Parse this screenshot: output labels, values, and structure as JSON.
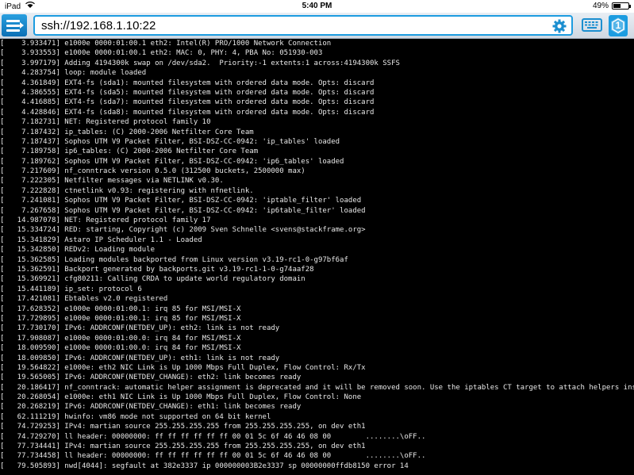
{
  "status_bar": {
    "device": "iPad",
    "time": "5:40 PM",
    "battery_percent": "49%",
    "battery_level": 0.49
  },
  "toolbar": {
    "address": "ssh://192.168.1.10:22",
    "info_badge": "1"
  },
  "colors": {
    "accent": "#1c9ce0",
    "terminal_bg": "#000000",
    "terminal_fg": "#e8e8e8"
  },
  "icons": {
    "menu": "menu-icon",
    "settings": "gear-icon",
    "keyboard": "keyboard-icon",
    "info": "info-badge-icon"
  },
  "terminal": {
    "lines": [
      "[    3.933471] e1000e 0000:01:00.1 eth2: Intel(R) PRO/1000 Network Connection",
      "[    3.933553] e1000e 0000:01:00.1 eth2: MAC: 0, PHY: 4, PBA No: 051930-003",
      "[    3.997179] Adding 4194300k swap on /dev/sda2.  Priority:-1 extents:1 across:4194300k SSFS",
      "[    4.283754] loop: module loaded",
      "[    4.361849] EXT4-fs (sda1): mounted filesystem with ordered data mode. Opts: discard",
      "[    4.386555] EXT4-fs (sda5): mounted filesystem with ordered data mode. Opts: discard",
      "[    4.416885] EXT4-fs (sda7): mounted filesystem with ordered data mode. Opts: discard",
      "[    4.428846] EXT4-fs (sda8): mounted filesystem with ordered data mode. Opts: discard",
      "[    7.182731] NET: Registered protocol family 10",
      "[    7.187432] ip_tables: (C) 2000-2006 Netfilter Core Team",
      "[    7.187437] Sophos UTM V9 Packet Filter, BSI-DSZ-CC-0942: 'ip_tables' loaded",
      "[    7.189758] ip6_tables: (C) 2000-2006 Netfilter Core Team",
      "[    7.189762] Sophos UTM V9 Packet Filter, BSI-DSZ-CC-0942: 'ip6_tables' loaded",
      "[    7.217609] nf_conntrack version 0.5.0 (312500 buckets, 2500000 max)",
      "[    7.222305] Netfilter messages via NETLINK v0.30.",
      "[    7.222828] ctnetlink v0.93: registering with nfnetlink.",
      "[    7.241081] Sophos UTM V9 Packet Filter, BSI-DSZ-CC-0942: 'iptable_filter' loaded",
      "[    7.267658] Sophos UTM V9 Packet Filter, BSI-DSZ-CC-0942: 'ip6table_filter' loaded",
      "[   14.987078] NET: Registered protocol family 17",
      "[   15.334724] RED: starting, Copyright (c) 2009 Sven Schnelle <svens@stackframe.org>",
      "[   15.341829] Astaro IP Scheduler 1.1 - Loaded",
      "[   15.342850] REDv2: Loading module",
      "[   15.362585] Loading modules backported from Linux version v3.19-rc1-0-g97bf6af",
      "[   15.362591] Backport generated by backports.git v3.19-rc1-1-0-g74aaf28",
      "[   15.369921] cfg80211: Calling CRDA to update world regulatory domain",
      "[   15.441189] ip_set: protocol 6",
      "[   17.421081] Ebtables v2.0 registered",
      "[   17.628352] e1000e 0000:01:00.1: irq 85 for MSI/MSI-X",
      "[   17.729895] e1000e 0000:01:00.1: irq 85 for MSI/MSI-X",
      "[   17.730170] IPv6: ADDRCONF(NETDEV_UP): eth2: link is not ready",
      "[   17.908087] e1000e 0000:01:00.0: irq 84 for MSI/MSI-X",
      "[   18.009590] e1000e 0000:01:00.0: irq 84 for MSI/MSI-X",
      "[   18.009850] IPv6: ADDRCONF(NETDEV_UP): eth1: link is not ready",
      "[   19.564822] e1000e: eth2 NIC Link is Up 1000 Mbps Full Duplex, Flow Control: Rx/Tx",
      "[   19.565005] IPv6: ADDRCONF(NETDEV_CHANGE): eth2: link becomes ready",
      "[   20.186417] nf_conntrack: automatic helper assignment is deprecated and it will be removed soon. Use the iptables CT target to attach helpers instead.",
      "[   20.268054] e1000e: eth1 NIC Link is Up 1000 Mbps Full Duplex, Flow Control: None",
      "[   20.268219] IPv6: ADDRCONF(NETDEV_CHANGE): eth1: link becomes ready",
      "[   62.111219] hwinfo: vm86 mode not supported on 64 bit kernel",
      "[   74.729253] IPv4: martian source 255.255.255.255 from 255.255.255.255, on dev eth1",
      "[   74.729270] ll header: 00000000: ff ff ff ff ff ff 00 01 5c 6f 46 46 08 00        ........\\oFF..",
      "[   77.734441] IPv4: martian source 255.255.255.255 from 255.255.255.255, on dev eth1",
      "[   77.734458] ll header: 00000000: ff ff ff ff ff ff 00 01 5c 6f 46 46 08 00        ........\\oFF..",
      "[   79.505893] nwd[4044]: segfault at 382e3337 ip 000000003B2e3337 sp 00000000ffdb8150 error 14"
    ]
  }
}
